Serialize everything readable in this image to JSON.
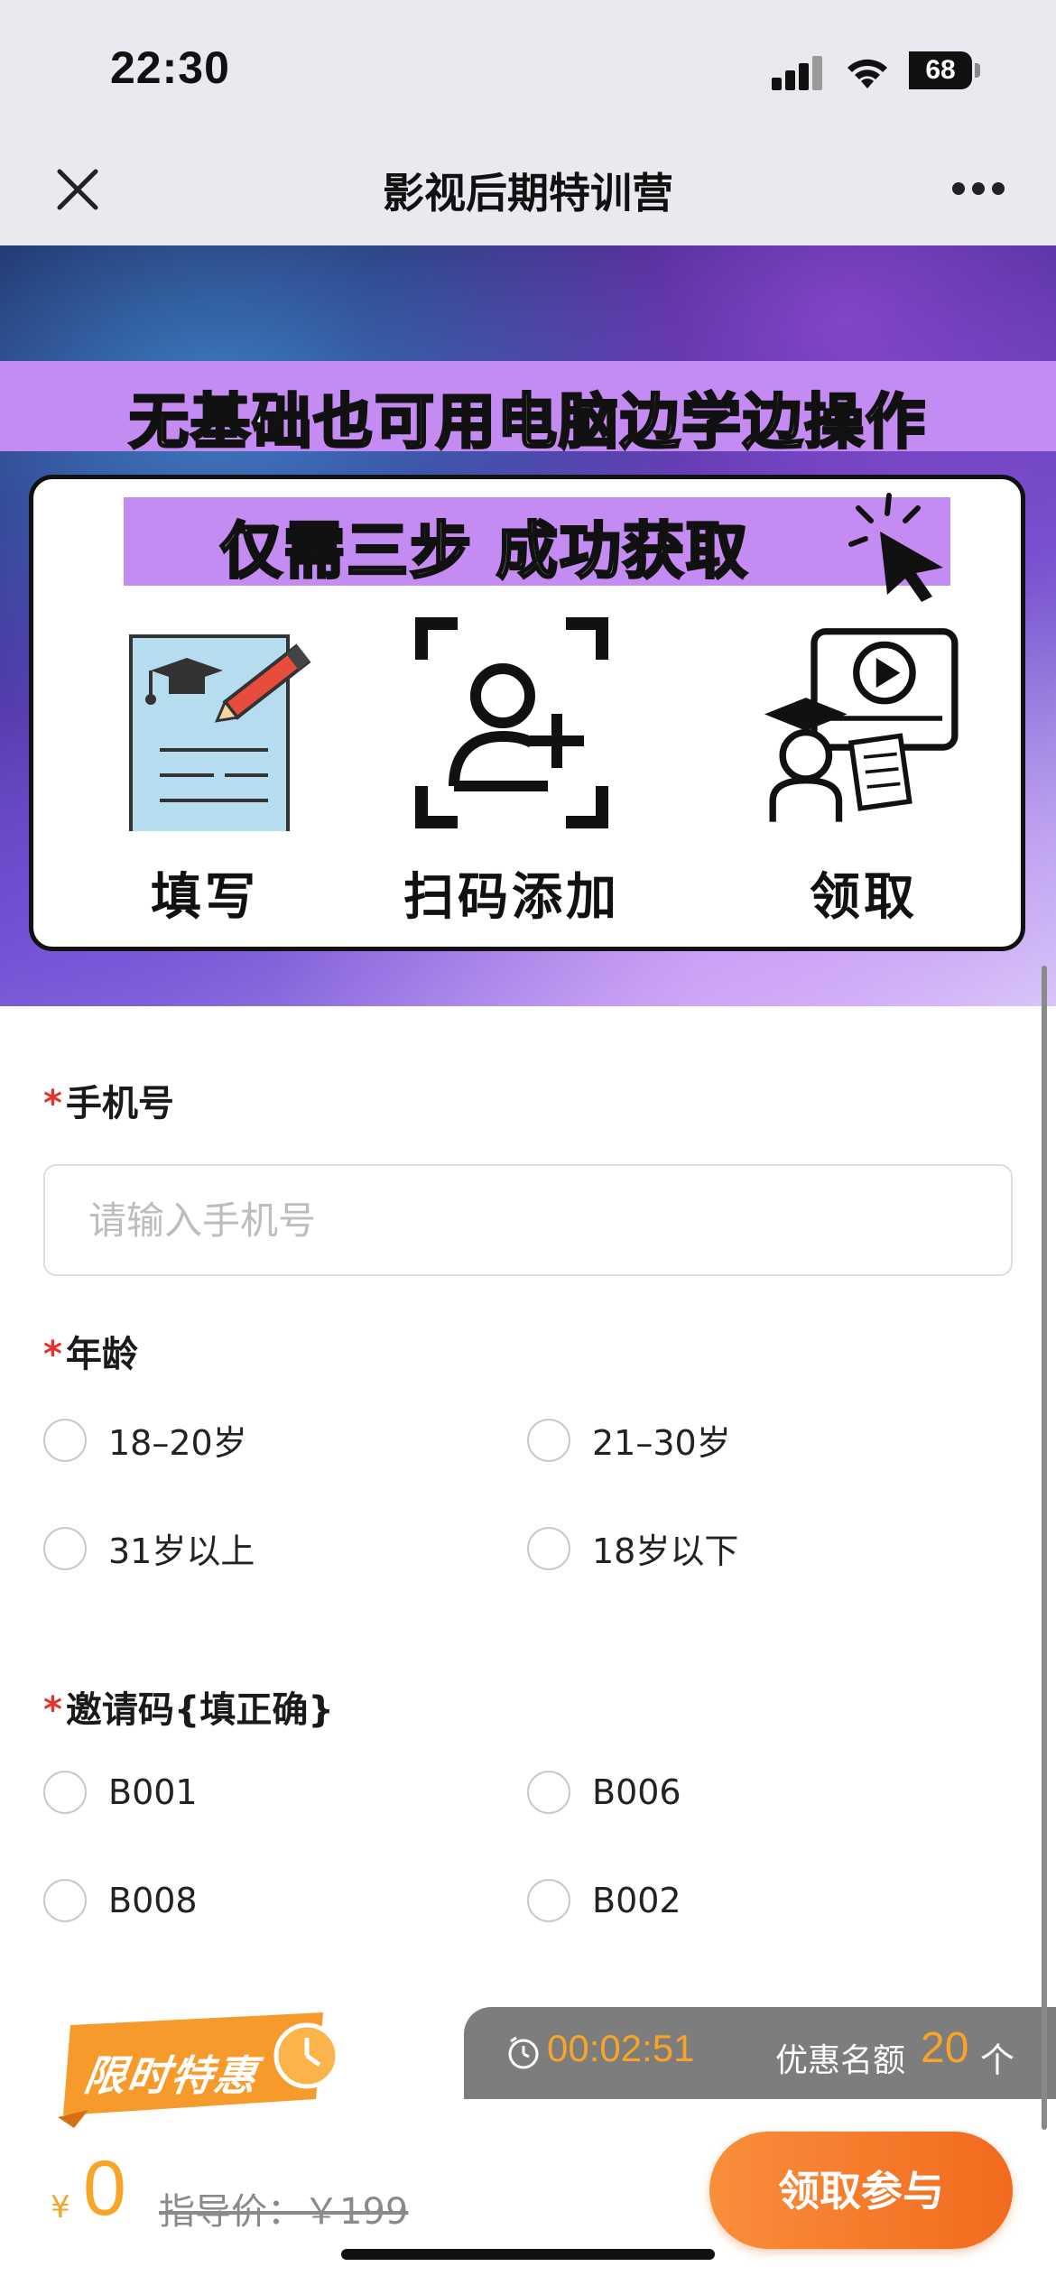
{
  "status_bar": {
    "time": "22:30",
    "battery": "68"
  },
  "nav": {
    "title": "影视后期特训营"
  },
  "banner": {
    "headline": "无基础也可用电脑边学边操作",
    "steps_title": "仅需三步 成功获取",
    "steps": [
      {
        "label": "填写",
        "icon": "form-pencil-icon"
      },
      {
        "label": "扫码添加",
        "icon": "scan-add-user-icon"
      },
      {
        "label": "领取",
        "icon": "video-course-icon"
      }
    ]
  },
  "form": {
    "phone": {
      "label": "手机号",
      "placeholder": "请输入手机号"
    },
    "age": {
      "label": "年龄",
      "options": [
        "18–20岁",
        "21–30岁",
        "31岁以上",
        "18岁以下"
      ]
    },
    "invite": {
      "label": "邀请码{填正确}",
      "options": [
        "B001",
        "B006",
        "B008",
        "B002"
      ]
    },
    "required_mark": "*"
  },
  "promo": {
    "badge": "限时特惠",
    "timer": "00:02:51",
    "quota_label": "优惠名额",
    "quota_value": "20",
    "quota_unit": "个",
    "currency": "¥",
    "price": "0",
    "original_price": "指导价：￥199",
    "cta": "领取参与"
  },
  "colors": {
    "accent": "#f7a428",
    "cta_start": "#f98e3a",
    "cta_end": "#f26a1e",
    "required": "#e5322d",
    "banner_purple": "#c48cf2"
  }
}
